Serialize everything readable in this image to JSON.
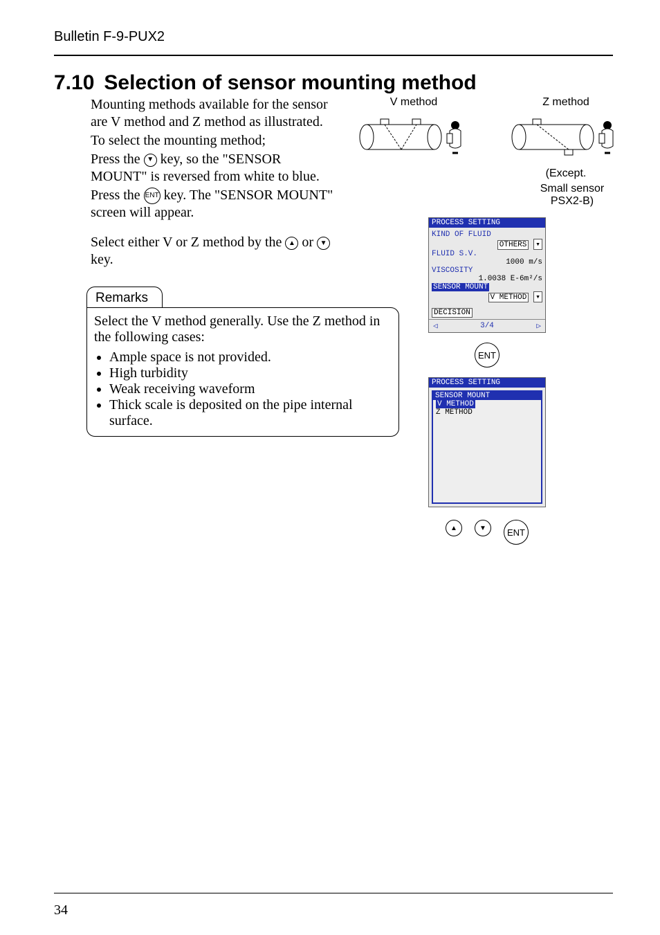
{
  "header": {
    "bulletin": "Bulletin F-9-PUX2"
  },
  "section": {
    "number": "7.10",
    "title": "Selection of sensor mounting method"
  },
  "intro": {
    "p1": "Mounting methods available for the sensor are V method and Z method as illustrated.",
    "p2": "To select the mounting method;",
    "p3a": "Press the ",
    "p3b": " key, so the \"SENSOR MOUNT\" is reversed from white to blue.",
    "p4a": "Press the ",
    "p4b": " key.  The \"SENSOR MOUNT\" screen will appear.",
    "p5a": "Select either V or Z method by the ",
    "p5b": " or ",
    "p5c": " key.",
    "k_down": "▼",
    "k_up": "▲",
    "k_ent": "ENT"
  },
  "remarks": {
    "title": "Remarks",
    "lead": "Select the V method generally.  Use the Z method in the following cases:",
    "b1": "Ample space is not provided.",
    "b2": "High turbidity",
    "b3": "Weak receiving waveform",
    "b4": "Thick scale is deposited on the pipe internal surface."
  },
  "diagrams": {
    "v_label": "V method",
    "z_label": "Z method",
    "z_note1": "(Except.",
    "z_note2": "Small sensor PSX2-B)"
  },
  "lcd1": {
    "title": "PROCESS SETTING",
    "kind_lbl": "KIND OF FLUID",
    "kind_val": "OTHERS",
    "sv_lbl": "FLUID S.V.",
    "sv_val": "1000 m/s",
    "visc_lbl": "VISCOSITY",
    "visc_val": "1.0038 E-6m²/s",
    "mount_lbl": "SENSOR MOUNT",
    "mount_val": "V METHOD",
    "decision": "DECISION",
    "nav_l": "◁",
    "nav_c": "3/4",
    "nav_r": "▷"
  },
  "lcd2": {
    "title": "PROCESS SETTING",
    "panel": "SENSOR MOUNT",
    "opt1": "V METHOD",
    "opt2": "Z METHOD"
  },
  "footer": {
    "page": "34"
  }
}
